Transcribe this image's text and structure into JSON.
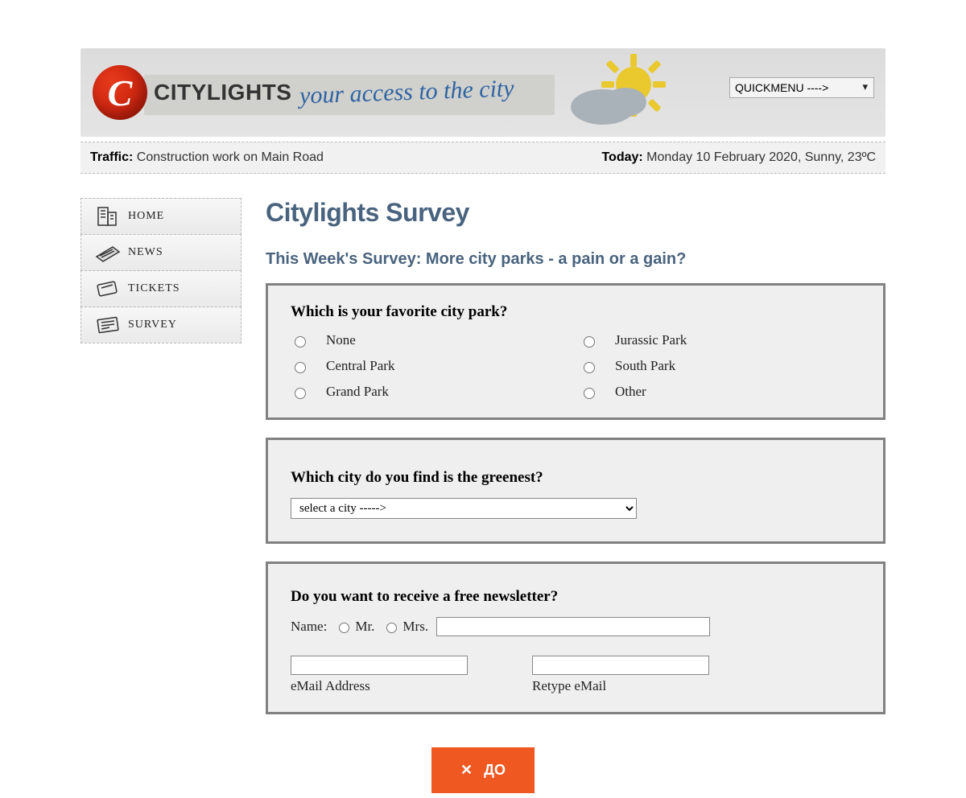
{
  "header": {
    "logo_letter": "C",
    "brand": "CITYLIGHTS",
    "tagline": "your access to the city",
    "quickmenu_selected": "QUICKMENU ---->"
  },
  "announce": {
    "traffic_label": "Traffic:",
    "traffic_text": "Construction work on Main Road",
    "today_label": "Today:",
    "today_text": "Monday 10 February 2020, Sunny, 23ºC"
  },
  "sidebar": {
    "items": [
      {
        "label": "HOME"
      },
      {
        "label": "NEWS"
      },
      {
        "label": "TICKETS"
      },
      {
        "label": "SURVEY"
      }
    ]
  },
  "page": {
    "title": "Citylights Survey",
    "subtitle": "This Week's Survey: More city parks - a pain or a gain?"
  },
  "q1": {
    "legend": "Which is your favorite city park?",
    "options": [
      "None",
      "Central Park",
      "Grand Park",
      "Jurassic Park",
      "South Park",
      "Other"
    ]
  },
  "q2": {
    "legend": "Which city do you find is the greenest?",
    "selected": "select a city ----->"
  },
  "q3": {
    "legend": "Do you want to receive a free newsletter?",
    "name_label": "Name:",
    "mr": "Mr.",
    "mrs": "Mrs.",
    "email_label": "eMail Address",
    "retype_label": "Retype eMail"
  },
  "bottom_button": "ДО"
}
